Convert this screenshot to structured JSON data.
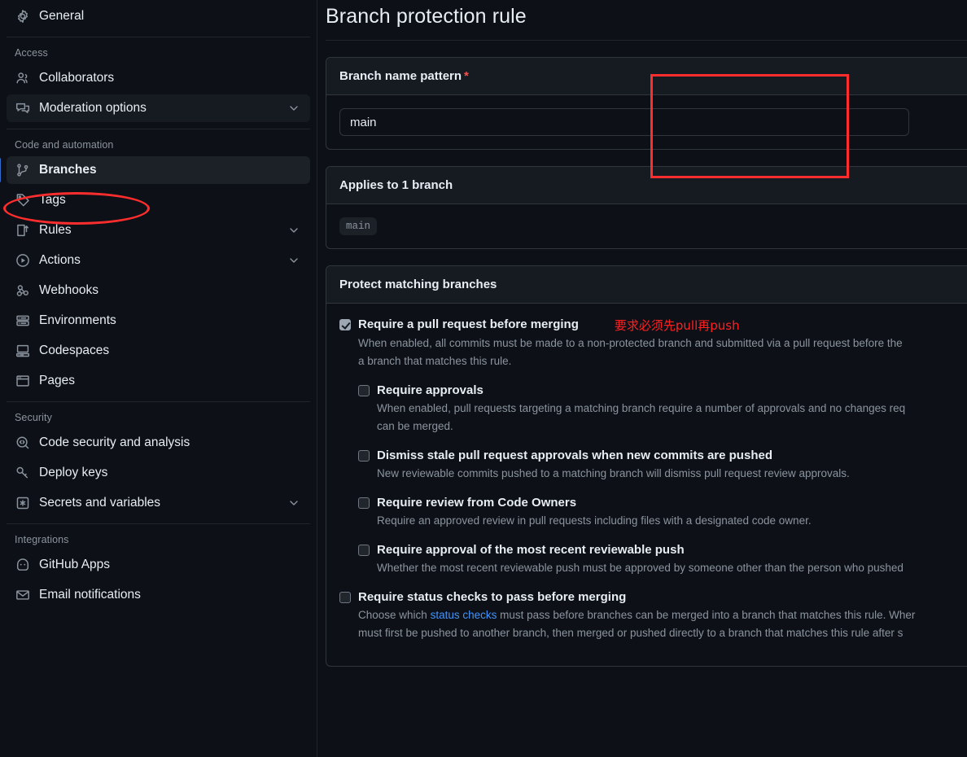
{
  "sidebar": {
    "top_items": [
      {
        "label": "General",
        "icon": "gear-icon",
        "name": "general"
      }
    ],
    "sections": [
      {
        "title": "Access",
        "items": [
          {
            "label": "Collaborators",
            "icon": "people-icon",
            "name": "collaborators",
            "expandable": false,
            "shaded": false,
            "active": false
          },
          {
            "label": "Moderation options",
            "icon": "comment-discussion-icon",
            "name": "moderation-options",
            "expandable": true,
            "shaded": true,
            "active": false
          }
        ]
      },
      {
        "title": "Code and automation",
        "items": [
          {
            "label": "Branches",
            "icon": "git-branch-icon",
            "name": "branches",
            "expandable": false,
            "shaded": false,
            "active": true
          },
          {
            "label": "Tags",
            "icon": "tag-icon",
            "name": "tags",
            "expandable": false,
            "shaded": false,
            "active": false
          },
          {
            "label": "Rules",
            "icon": "rules-icon",
            "name": "rules",
            "expandable": true,
            "shaded": false,
            "active": false
          },
          {
            "label": "Actions",
            "icon": "play-icon",
            "name": "actions",
            "expandable": true,
            "shaded": false,
            "active": false
          },
          {
            "label": "Webhooks",
            "icon": "webhook-icon",
            "name": "webhooks",
            "expandable": false,
            "shaded": false,
            "active": false
          },
          {
            "label": "Environments",
            "icon": "server-icon",
            "name": "environments",
            "expandable": false,
            "shaded": false,
            "active": false
          },
          {
            "label": "Codespaces",
            "icon": "codespaces-icon",
            "name": "codespaces",
            "expandable": false,
            "shaded": false,
            "active": false
          },
          {
            "label": "Pages",
            "icon": "browser-icon",
            "name": "pages",
            "expandable": false,
            "shaded": false,
            "active": false
          }
        ]
      },
      {
        "title": "Security",
        "items": [
          {
            "label": "Code security and analysis",
            "icon": "codescan-icon",
            "name": "code-security-and-analysis",
            "expandable": false,
            "shaded": false,
            "active": false
          },
          {
            "label": "Deploy keys",
            "icon": "key-icon",
            "name": "deploy-keys",
            "expandable": false,
            "shaded": false,
            "active": false
          },
          {
            "label": "Secrets and variables",
            "icon": "asterisk-key-icon",
            "name": "secrets-and-variables",
            "expandable": true,
            "shaded": false,
            "active": false
          }
        ]
      },
      {
        "title": "Integrations",
        "items": [
          {
            "label": "GitHub Apps",
            "icon": "apps-icon",
            "name": "github-apps",
            "expandable": false,
            "shaded": false,
            "active": false
          },
          {
            "label": "Email notifications",
            "icon": "mail-icon",
            "name": "email-notifications",
            "expandable": false,
            "shaded": false,
            "active": false
          }
        ]
      }
    ]
  },
  "main": {
    "page_title": "Branch protection rule",
    "branch_pattern_card": {
      "heading": "Branch name pattern",
      "required_marker": "*",
      "input_value": "main",
      "input_placeholder": ""
    },
    "applies_to_card": {
      "heading": "Applies to 1 branch",
      "branches": [
        "main"
      ]
    },
    "protect_card": {
      "heading": "Protect matching branches",
      "options": [
        {
          "name": "require-pull-request-before-merging",
          "title": "Require a pull request before merging",
          "checked": true,
          "desc": "When enabled, all commits must be made to a non-protected branch and submitted via a pull request before the",
          "desc2": "a branch that matches this rule.",
          "annotation": "要求必须先pull再push",
          "sub_options": [
            {
              "name": "require-approvals",
              "title": "Require approvals",
              "checked": false,
              "desc": "When enabled, pull requests targeting a matching branch require a number of approvals and no changes req",
              "desc2": "can be merged."
            },
            {
              "name": "dismiss-stale-pull-request-approvals",
              "title": "Dismiss stale pull request approvals when new commits are pushed",
              "checked": false,
              "desc": "New reviewable commits pushed to a matching branch will dismiss pull request review approvals.",
              "desc2": ""
            },
            {
              "name": "require-review-from-code-owners",
              "title": "Require review from Code Owners",
              "checked": false,
              "desc": "Require an approved review in pull requests including files with a designated code owner.",
              "desc2": ""
            },
            {
              "name": "require-approval-most-recent-reviewable-push",
              "title": "Require approval of the most recent reviewable push",
              "checked": false,
              "desc": "Whether the most recent reviewable push must be approved by someone other than the person who pushed",
              "desc2": ""
            }
          ]
        },
        {
          "name": "require-status-checks-to-pass",
          "title": "Require status checks to pass before merging",
          "checked": false,
          "desc_pre": "Choose which ",
          "desc_link": "status checks",
          "desc_post": " must pass before branches can be merged into a branch that matches this rule. Wher",
          "desc2": "must first be pushed to another branch, then merged or pushed directly to a branch that matches this rule after s",
          "sub_options": []
        }
      ]
    }
  },
  "annotations": {
    "ellipse_color": "#ff2d2d",
    "rect_color": "#ff2d2d",
    "text_color": "#ff2020"
  },
  "colors": {
    "background": "#0d1117",
    "card_header": "#161b22",
    "border": "#30363d",
    "accent": "#316dca",
    "link": "#4493f8",
    "text": "#e6edf3",
    "muted": "#8b949e",
    "required": "#f85149"
  }
}
